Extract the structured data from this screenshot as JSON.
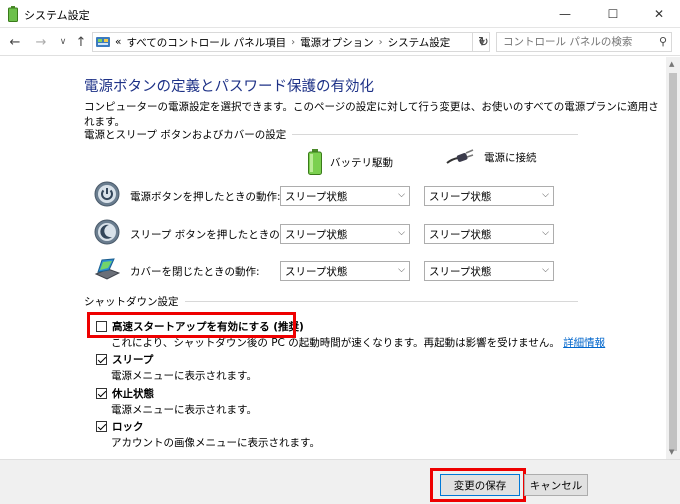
{
  "window": {
    "title": "システム設定",
    "minimize": "—",
    "maximize": "☐",
    "close": "✕"
  },
  "nav": {
    "back": "←",
    "forward": "→",
    "recent": "∨",
    "up": "↑",
    "breadcrumbs": [
      "すべてのコントロール パネル項目",
      "電源オプション",
      "システム設定"
    ],
    "breadcrumb_prefix": "«",
    "refresh": "↻",
    "search_placeholder": "コントロール パネルの検索"
  },
  "page": {
    "heading": "電源ボタンの定義とパスワード保護の有効化",
    "description": "コンピューターの電源設定を選択できます。このページの設定に対して行う変更は、お使いのすべての電源プランに適用されます。"
  },
  "power_section": {
    "title": "電源とスリープ ボタンおよびカバーの設定",
    "col_battery": "バッテリ駆動",
    "col_plugged": "電源に接続",
    "rows": [
      {
        "label": "電源ボタンを押したときの動作:",
        "battery": "スリープ状態",
        "plugged": "スリープ状態"
      },
      {
        "label": "スリープ ボタンを押したときの動作:",
        "battery": "スリープ状態",
        "plugged": "スリープ状態"
      },
      {
        "label": "カバーを閉じたときの動作:",
        "battery": "スリープ状態",
        "plugged": "スリープ状態"
      }
    ]
  },
  "shutdown_section": {
    "title": "シャットダウン設定",
    "fast_startup": {
      "label": "高速スタートアップを有効にする (推奨)",
      "checked": false,
      "desc": "これにより、シャットダウン後の PC の起動時間が速くなります。再起動は影響を受けません。",
      "link": "詳細情報"
    },
    "sleep": {
      "label": "スリープ",
      "checked": true,
      "desc": "電源メニューに表示されます。"
    },
    "hibernate": {
      "label": "休止状態",
      "checked": true,
      "desc": "電源メニューに表示されます。"
    },
    "lock": {
      "label": "ロック",
      "checked": true,
      "desc": "アカウントの画像メニューに表示されます。"
    }
  },
  "footer": {
    "save": "変更の保存",
    "cancel": "キャンセル"
  }
}
